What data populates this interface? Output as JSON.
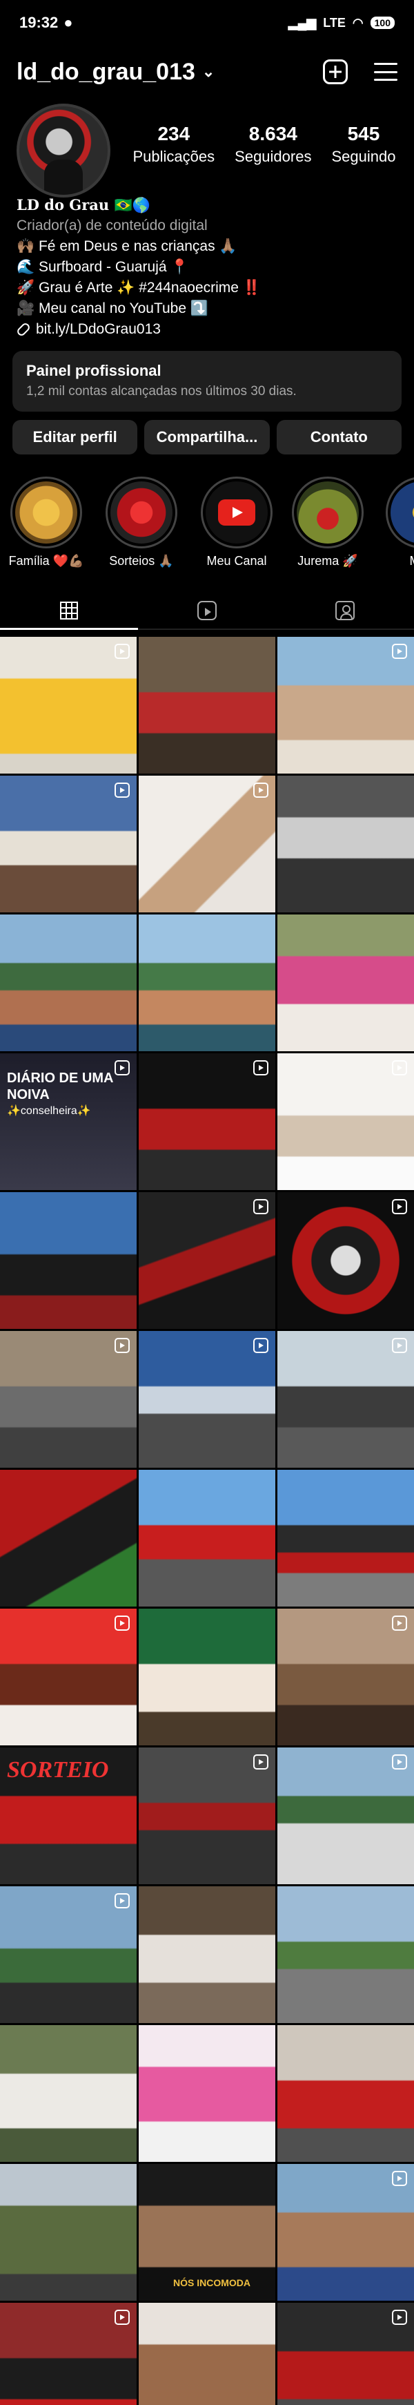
{
  "status_bar": {
    "time": "19:32",
    "network": "LTE",
    "battery": "100"
  },
  "header": {
    "username": "ld_do_grau_013"
  },
  "profile": {
    "stats": [
      {
        "value": "234",
        "label": "Publicações"
      },
      {
        "value": "8.634",
        "label": "Seguidores"
      },
      {
        "value": "545",
        "label": "Seguindo"
      }
    ],
    "name": "LD do Grau 🇧🇷🌎",
    "category": "Criador(a) de conteúdo digital",
    "bio_lines": [
      "🙌🏽 Fé em Deus e nas crianças 🙏🏽",
      "🌊 Surfboard - Guarujá 📍",
      "🚀 Grau é Arte ✨ #244naoecrime ‼️",
      "🎥 Meu canal no YouTube ⤵️"
    ],
    "link": "bit.ly/LDdoGrau013"
  },
  "pro_panel": {
    "title": "Painel profissional",
    "subtitle": "1,2 mil contas alcançadas nos últimos 30 dias."
  },
  "buttons": {
    "edit": "Editar perfil",
    "share": "Compartilha...",
    "contact": "Contato"
  },
  "highlights": [
    {
      "label": "Família ❤️💪🏽",
      "color": "#d8a13b"
    },
    {
      "label": "Sorteios 🙏🏽",
      "color": "#b3141a"
    },
    {
      "label": "Meu Canal",
      "color": "#e5221c"
    },
    {
      "label": "Jurema 🚀",
      "color": "#7a8a2f"
    },
    {
      "label": "Mari",
      "color": "#1c3d7a"
    }
  ],
  "grid_overlays": {
    "diario_line1": "DIÁRIO DE UMA",
    "diario_line2": "NOIVA",
    "diario_line3": "✨conselheira✨",
    "sorteio": "SORTEIO",
    "nos_incomoda": "NÓS INCOMODA"
  }
}
